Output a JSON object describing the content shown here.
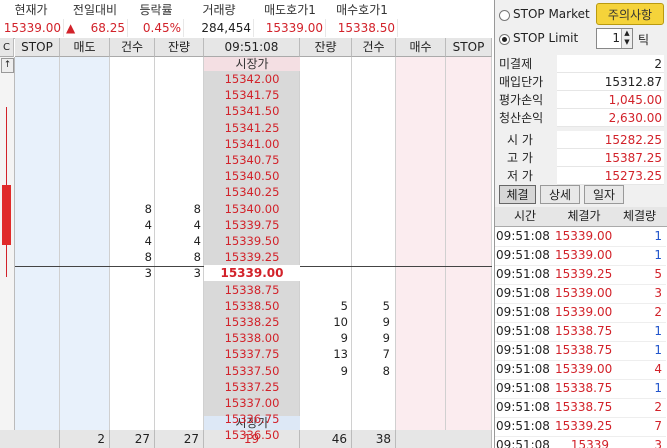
{
  "summary": {
    "headers": [
      "현재가",
      "전일대비",
      "등락률",
      "거래량",
      "매도호가1",
      "매수호가1"
    ],
    "current_price": "15339.00",
    "change_arrow": "▲",
    "change": "68.25",
    "change_rate": "0.45%",
    "volume": "284,454",
    "ask1": "15339.00",
    "bid1": "15338.50"
  },
  "grid": {
    "headers": [
      "STOP",
      "매도",
      "건수",
      "잔량",
      "09:51:08",
      "잔량",
      "건수",
      "매수",
      "STOP"
    ],
    "left_strip_labels": [
      "C",
      "↑"
    ],
    "market_price_label": "시장가",
    "current_price": "15339.00",
    "sell_prices": [
      "15342.00",
      "15341.75",
      "15341.50",
      "15341.25",
      "15341.00",
      "15340.75",
      "15340.50",
      "15340.25",
      "15340.00",
      "15339.75",
      "15339.50",
      "15339.25"
    ],
    "sell_counts": [
      "",
      "",
      "",
      "",
      "",
      "",
      "",
      "",
      "8",
      "4",
      "4",
      "8",
      "3"
    ],
    "sell_qty": [
      "",
      "",
      "",
      "",
      "",
      "",
      "",
      "",
      "8",
      "4",
      "4",
      "8",
      "3"
    ],
    "buy_prices": [
      "15338.75",
      "15338.50",
      "15338.25",
      "15338.00",
      "15337.75",
      "15337.50",
      "15337.25",
      "15337.00",
      "15336.75",
      "15336.50"
    ],
    "buy_qty": [
      "",
      "5",
      "9",
      "9",
      "7",
      "8",
      "",
      "",
      "",
      ""
    ],
    "buy_counts": [
      "",
      "5",
      "10",
      "9",
      "13",
      "9",
      "",
      "",
      "",
      ""
    ],
    "footer": {
      "sell_total": "2",
      "sell_count": "27",
      "sell_qty": "27",
      "center": "19",
      "buy_qty": "46",
      "buy_count": "38"
    }
  },
  "order_panel": {
    "stop_market": "STOP Market",
    "stop_limit": "STOP Limit",
    "notice_button": "주의사항",
    "tick_value": "1",
    "tick_unit": "틱"
  },
  "position": {
    "rows": [
      {
        "label": "미결제",
        "value": "2",
        "color": "#222222"
      },
      {
        "label": "매입단가",
        "value": "15312.87",
        "color": "#222222"
      },
      {
        "label": "평가손익",
        "value": "1,045.00",
        "color": "#d2222a"
      },
      {
        "label": "청산손익",
        "value": "2,630.00",
        "color": "#d2222a"
      }
    ],
    "quotes": [
      {
        "label": "시 가",
        "value": "15282.25",
        "color": "#d2222a"
      },
      {
        "label": "고 가",
        "value": "15387.25",
        "color": "#d2222a"
      },
      {
        "label": "저 가",
        "value": "15273.25",
        "color": "#d2222a"
      }
    ]
  },
  "trades": {
    "tabs": [
      "체결",
      "상세",
      "일자"
    ],
    "headers": [
      "시간",
      "체결가",
      "체결량"
    ],
    "rows": [
      {
        "time": "09:51:08",
        "price": "15339.00",
        "qty": "1",
        "qcolor": "#2255cc"
      },
      {
        "time": "09:51:08",
        "price": "15339.00",
        "qty": "1",
        "qcolor": "#2255cc"
      },
      {
        "time": "09:51:08",
        "price": "15339.25",
        "qty": "5",
        "qcolor": "#d2222a"
      },
      {
        "time": "09:51:08",
        "price": "15339.00",
        "qty": "3",
        "qcolor": "#d2222a"
      },
      {
        "time": "09:51:08",
        "price": "15339.00",
        "qty": "2",
        "qcolor": "#d2222a"
      },
      {
        "time": "09:51:08",
        "price": "15338.75",
        "qty": "1",
        "qcolor": "#2255cc"
      },
      {
        "time": "09:51:08",
        "price": "15338.75",
        "qty": "1",
        "qcolor": "#2255cc"
      },
      {
        "time": "09:51:08",
        "price": "15339.00",
        "qty": "4",
        "qcolor": "#d2222a"
      },
      {
        "time": "09:51:08",
        "price": "15338.75",
        "qty": "1",
        "qcolor": "#2255cc"
      },
      {
        "time": "09:51:08",
        "price": "15338.75",
        "qty": "2",
        "qcolor": "#d2222a"
      },
      {
        "time": "09:51:08",
        "price": "15339.25",
        "qty": "7",
        "qcolor": "#d2222a"
      },
      {
        "time": "09:51:08",
        "price": "15339",
        "qty": "3",
        "qcolor": "#d2222a"
      }
    ]
  },
  "colors": {
    "up": "#d2222a",
    "down": "#2255cc",
    "sell_bg": "#e8f1fb",
    "buy_bg": "#fbecef",
    "price_bg": "#d9d9d9"
  }
}
